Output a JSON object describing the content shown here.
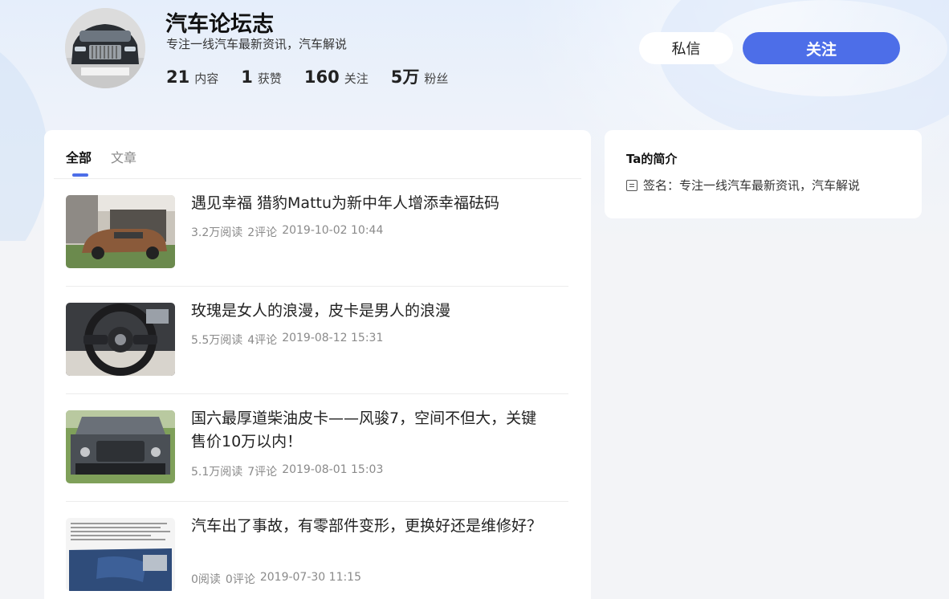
{
  "profile": {
    "name": "汽车论坛志",
    "bio": "专注一线汽车最新资讯，汽车解说",
    "stats": [
      {
        "num": "21",
        "label": "内容"
      },
      {
        "num": "1",
        "label": "获赞"
      },
      {
        "num": "160",
        "label": "关注"
      },
      {
        "num": "5万",
        "label": "粉丝"
      }
    ]
  },
  "actions": {
    "message_label": "私信",
    "follow_label": "关注"
  },
  "tabs": [
    {
      "label": "全部",
      "active": true
    },
    {
      "label": "文章",
      "active": false
    }
  ],
  "articles": [
    {
      "title": "遇见幸福 猎豹Mattu为新中年人增添幸福砝码",
      "reads": "3.2万阅读",
      "comments": "2评论",
      "date": "2019-10-02 10:44",
      "thumb": "brown-suv-icon"
    },
    {
      "title": "玫瑰是女人的浪漫，皮卡是男人的浪漫",
      "reads": "5.5万阅读",
      "comments": "4评论",
      "date": "2019-08-12 15:31",
      "thumb": "steering-wheel-icon"
    },
    {
      "title": "国六最厚道柴油皮卡——风骏7，空间不但大，关键售价10万以内！",
      "reads": "5.1万阅读",
      "comments": "7评论",
      "date": "2019-08-01 15:03",
      "thumb": "engine-bay-icon"
    },
    {
      "title": "汽车出了事故，有零部件变形，更换好还是维修好？",
      "reads": "0阅读",
      "comments": "0评论",
      "date": "2019-07-30 11:15",
      "thumb": "damaged-car-icon"
    }
  ],
  "intro": {
    "title": "Ta的简介",
    "signature": "签名：专注一线汽车最新资讯，汽车解说"
  },
  "colors": {
    "accent": "#4d6ee8",
    "page_bg": "#f3f4f7"
  }
}
